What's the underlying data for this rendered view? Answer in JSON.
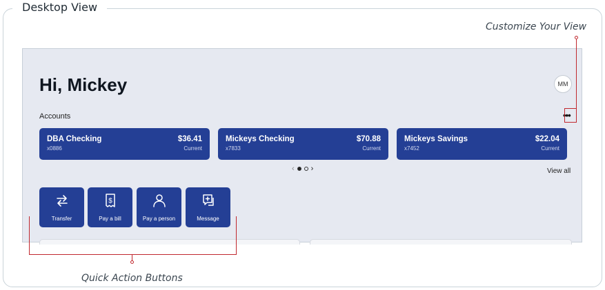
{
  "frame": {
    "title": "Desktop View"
  },
  "callouts": {
    "customize": "Customize Your View",
    "quick_actions": "Quick Action Buttons"
  },
  "greeting": "Hi, Mickey",
  "avatar_initials": "MM",
  "accounts": {
    "label": "Accounts",
    "more": "•••",
    "cards": [
      {
        "name": "DBA Checking",
        "number": "x0886",
        "amount": "$36.41",
        "status": "Current"
      },
      {
        "name": "Mickeys Checking",
        "number": "x7833",
        "amount": "$70.88",
        "status": "Current"
      },
      {
        "name": "Mickeys Savings",
        "number": "x7452",
        "amount": "$22.04",
        "status": "Current"
      }
    ],
    "pager": {
      "prev": "‹",
      "next": "›",
      "pages": 2,
      "current": 1
    },
    "view_all": "View all"
  },
  "quick_actions": [
    {
      "label": "Transfer",
      "icon": "transfer-icon"
    },
    {
      "label": "Pay a bill",
      "icon": "bill-icon"
    },
    {
      "label": "Pay a person",
      "icon": "person-icon"
    },
    {
      "label": "Message",
      "icon": "message-icon"
    }
  ],
  "colors": {
    "brand_blue": "#243f95",
    "screen_bg": "#e6e9f1",
    "callout_red": "#c0272d"
  }
}
